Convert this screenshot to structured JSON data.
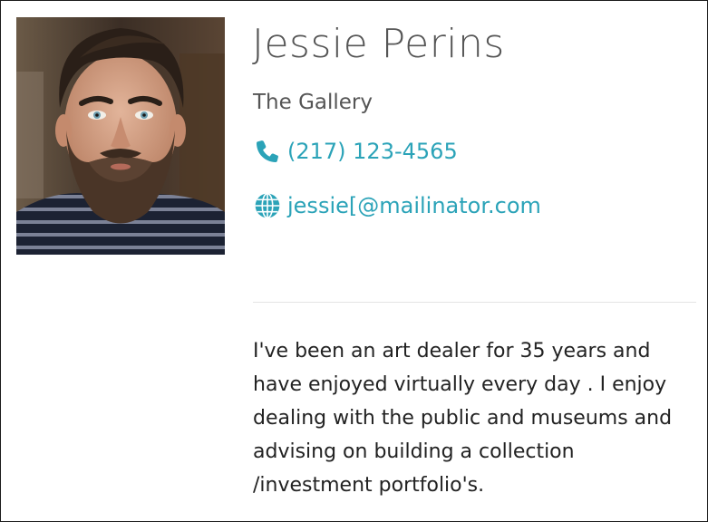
{
  "profile": {
    "name": "Jessie Perins",
    "company": "The Gallery",
    "phone": "(217) 123-4565",
    "email": "jessie[@mailinator.com",
    "bio": "I've been an art dealer for 35 years and have enjoyed virtually every day . I enjoy dealing with the public and museums and advising on building a collection /investment portfolio's.",
    "photo_alt": "Bearded man portrait"
  },
  "icons": {
    "phone": "phone-icon",
    "email": "globe-icon"
  },
  "colors": {
    "accent": "#2ba3b8",
    "text_muted": "#555555",
    "text_body": "#222222",
    "divider": "#e4e4e4"
  }
}
